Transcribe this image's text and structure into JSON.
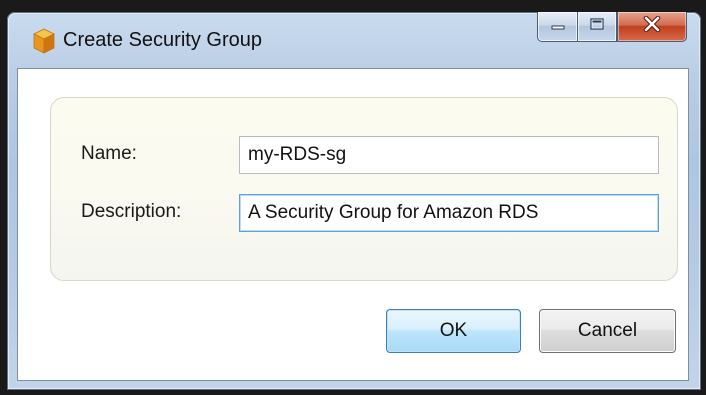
{
  "window": {
    "title": "Create Security Group",
    "app_icon": "orange-cube-icon",
    "caption_buttons": [
      {
        "name": "minimize-button",
        "icon": "minimize-icon"
      },
      {
        "name": "maximize-button",
        "icon": "maximize-icon"
      },
      {
        "name": "close-button",
        "icon": "close-icon"
      }
    ]
  },
  "form": {
    "name_label": "Name:",
    "name_value": "my-RDS-sg",
    "description_label": "Description:",
    "description_value": "A Security Group for Amazon RDS"
  },
  "buttons": {
    "ok_label": "OK",
    "cancel_label": "Cancel"
  },
  "colors": {
    "close_button": "#c0401f",
    "ok_button": "#bee6fd",
    "group_background": "#fafaf1",
    "focus_border": "#5aa2dc"
  }
}
